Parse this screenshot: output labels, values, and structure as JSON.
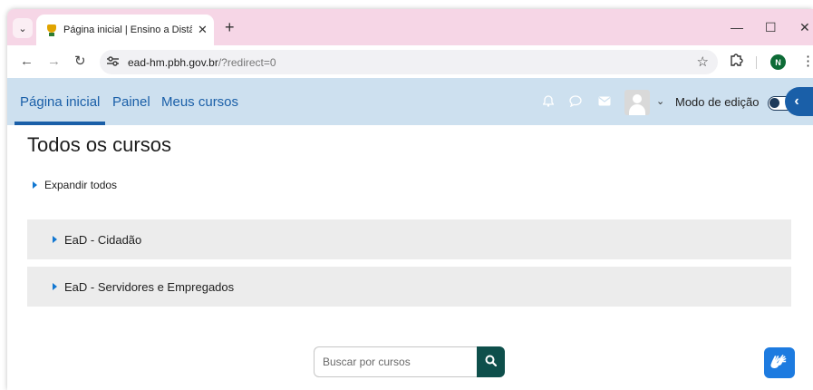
{
  "browser": {
    "tab_title": "Página inicial | Ensino a Distânc",
    "tab_close": "✕",
    "new_tab": "+",
    "url_host": "ead-hm.pbh.gov.br",
    "url_path": "/?redirect=0",
    "profile_initial": "N",
    "window_controls": {
      "minimize": "—",
      "maximize": "☐",
      "close": "✕"
    }
  },
  "navbar": {
    "links": [
      "Página inicial",
      "Painel",
      "Meus cursos"
    ],
    "active_link": "Página inicial",
    "edit_mode_label": "Modo de edição",
    "edit_mode_on": false
  },
  "main": {
    "title": "Todos os cursos",
    "expand_all": "Expandir todos",
    "categories": [
      "EaD - Cidadão",
      "EaD - Servidores e Empregados"
    ],
    "search_placeholder": "Buscar por cursos"
  },
  "icons": {
    "tab_menu": "chevron-down-icon",
    "back": "arrow-left-icon",
    "forward": "arrow-right-icon",
    "reload": "reload-icon",
    "site_info": "tune-icon",
    "bookmark": "star-icon",
    "extensions": "puzzle-icon",
    "menu": "kebab-icon",
    "notifications": "bell-icon",
    "messages": "chat-icon",
    "mail": "envelope-icon",
    "drawer": "chevron-left-icon",
    "search": "search-icon",
    "accessibility": "vlibras-hands-icon"
  },
  "colors": {
    "tabstrip": "#f6d6e6",
    "navbar": "#cde0ef",
    "link": "#1a5fa8",
    "search_button": "#0e4f4b",
    "vlibras": "#1d7be0"
  }
}
